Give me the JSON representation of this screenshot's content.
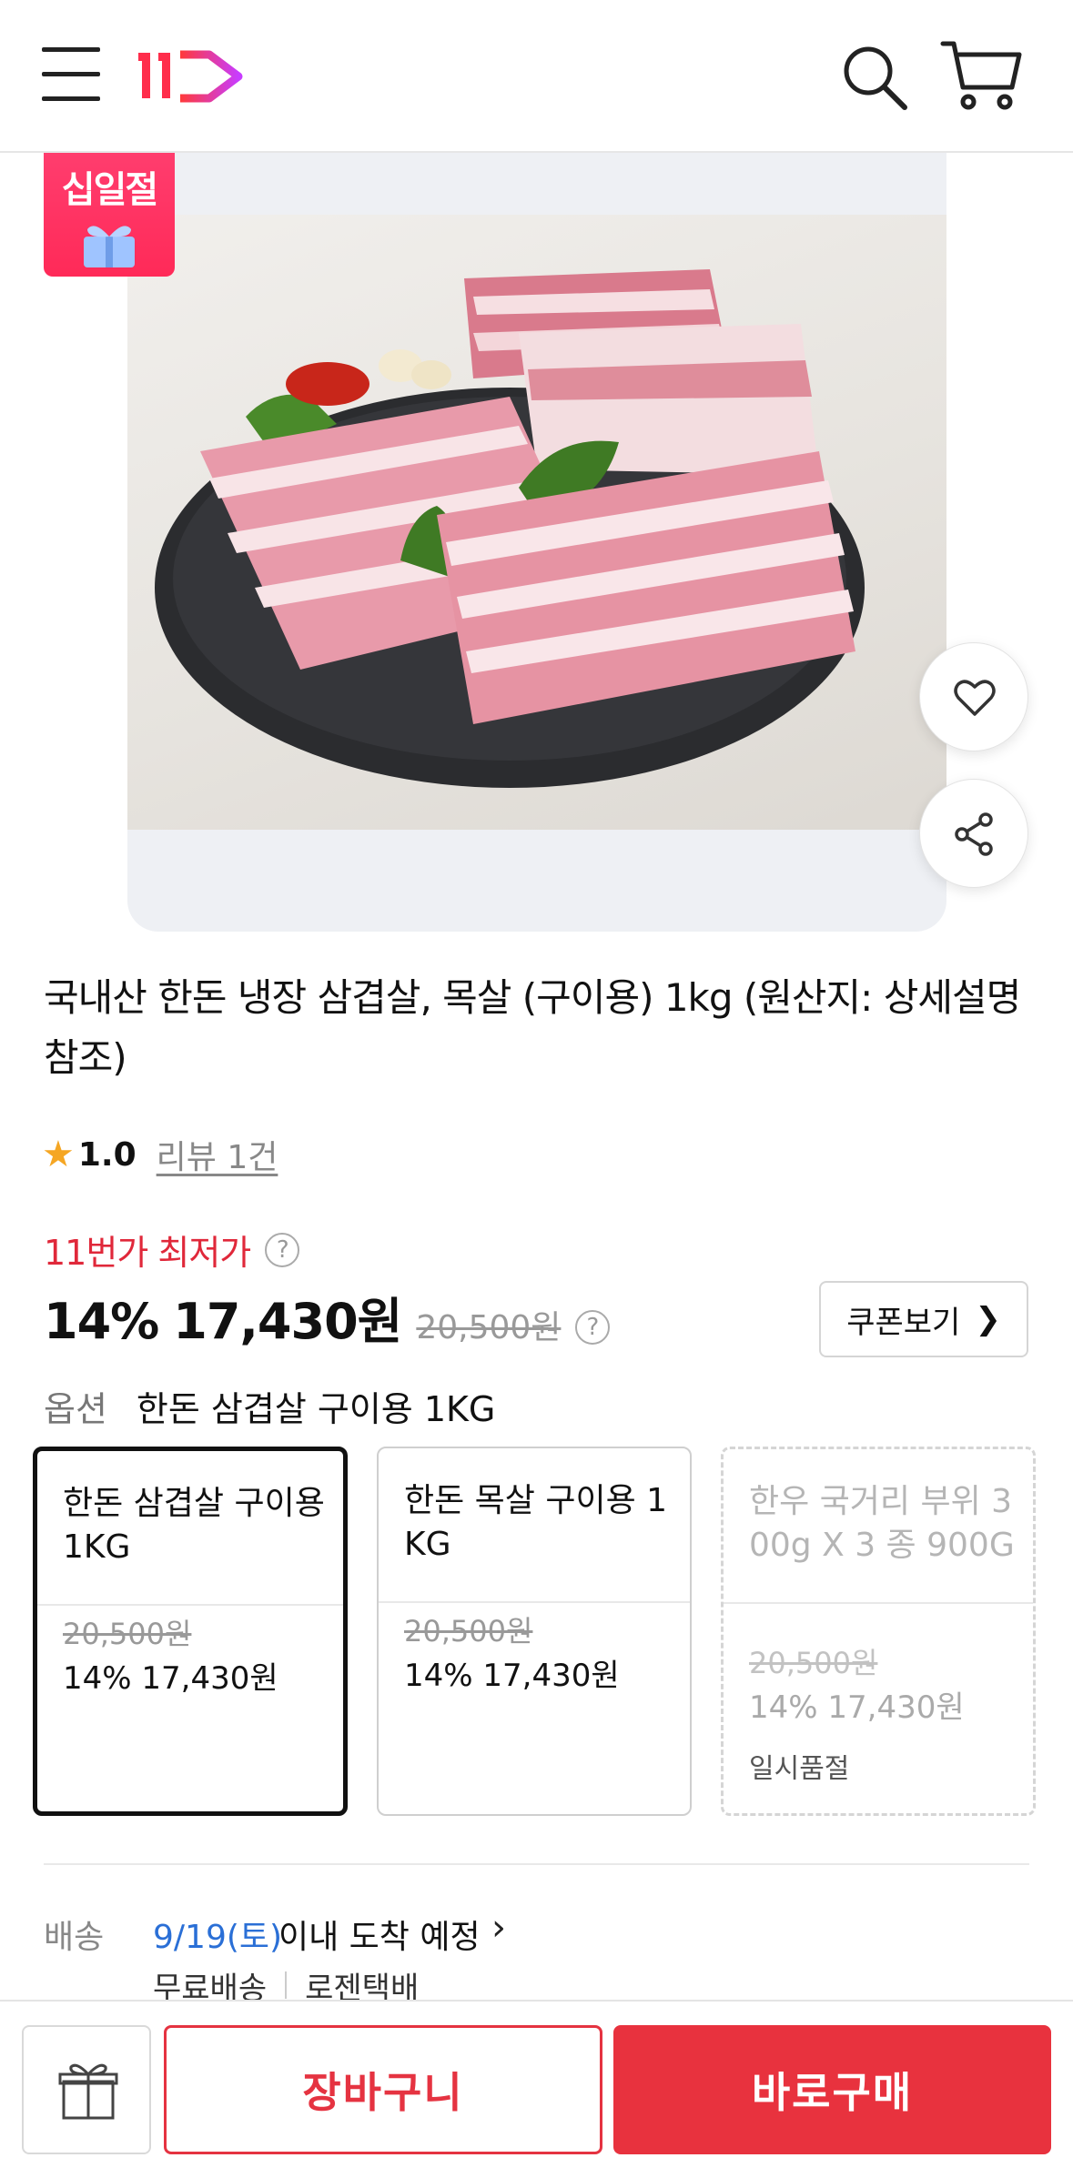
{
  "header": {
    "logo_text": "11",
    "menu_icon": "hamburger-menu-icon",
    "search_icon": "search-icon",
    "cart_icon": "cart-icon"
  },
  "badge": {
    "text": "십일절"
  },
  "product": {
    "title": "국내산 한돈 냉장 삼겹살, 목살 (구이용) 1kg (원산지: 상세설명 참조)",
    "rating": "1.0",
    "review_link": "리뷰 1건",
    "lowest_label": "11번가 최저가",
    "discount": "14%",
    "sale_price": "17,430원",
    "original_price": "20,500원",
    "coupon_button": "쿠폰보기",
    "option_label": "옵션",
    "option_selected": "한돈 삼겹살 구이용 1KG"
  },
  "options": [
    {
      "name": "한돈 삼겹살 구이용 1KG",
      "original": "20,500원",
      "price": "14% 17,430원",
      "status": ""
    },
    {
      "name": "한돈 목살 구이용 1KG",
      "original": "20,500원",
      "price": "14% 17,430원",
      "status": ""
    },
    {
      "name": "한우 국거리 부위 300g X 3 종 900G",
      "original": "20,500원",
      "price": "14% 17,430원",
      "status": "일시품절"
    }
  ],
  "delivery": {
    "label": "배송",
    "date": "9/19(토)",
    "text": "이내 도착 예정",
    "free": "무료배송",
    "courier": "로젠택배"
  },
  "bottom": {
    "cart_button": "장바구니",
    "buy_button": "바로구매",
    "gift_icon": "gift-icon"
  },
  "colors": {
    "accent": "#e8323e",
    "lowest_price": "#e0283a",
    "delivery_date": "#2a6fd6",
    "star": "#f5a623"
  }
}
